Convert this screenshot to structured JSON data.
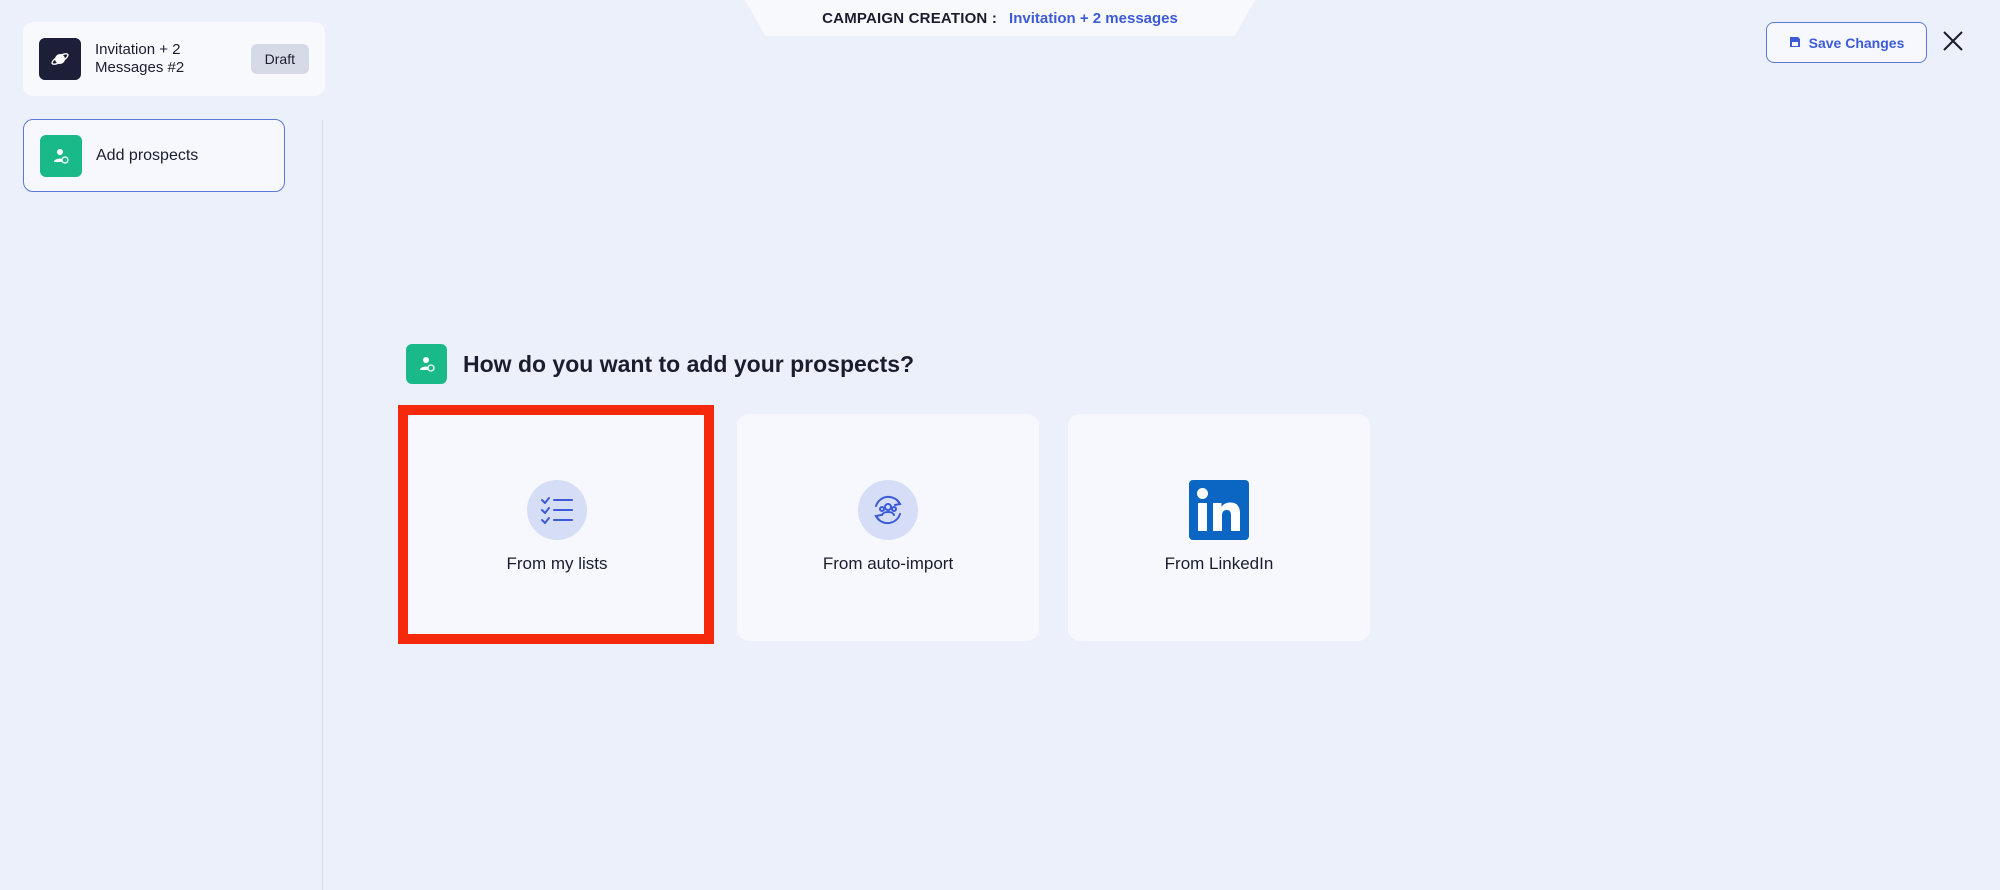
{
  "banner": {
    "label": "CAMPAIGN CREATION :",
    "campaign": "Invitation + 2 messages"
  },
  "campaign_card": {
    "title": "Invitation + 2 Messages #2",
    "status": "Draft"
  },
  "sidebar": {
    "steps": [
      {
        "label": "Add prospects",
        "icon": "add-user-icon"
      }
    ]
  },
  "toolbar": {
    "save_label": "Save Changes",
    "close_icon": "close-icon"
  },
  "main": {
    "question": "How do you want to add your prospects?",
    "options": [
      {
        "label": "From my lists",
        "icon": "checklist-icon"
      },
      {
        "label": "From auto-import",
        "icon": "sync-people-icon"
      },
      {
        "label": "From LinkedIn",
        "icon": "linkedin-logo-icon"
      }
    ]
  },
  "colors": {
    "background": "#ecf0fb",
    "accent": "#3d5bd6",
    "green": "#19b98a",
    "highlight": "#f52a0c",
    "linkedin": "#0a66c2"
  }
}
